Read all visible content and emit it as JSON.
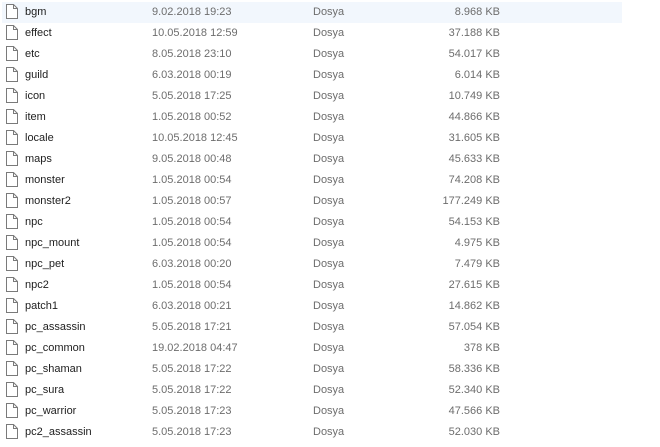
{
  "files": [
    {
      "name": "bgm",
      "date": "9.02.2018 19:23",
      "type": "Dosya",
      "size": "8.968 KB"
    },
    {
      "name": "effect",
      "date": "10.05.2018 12:59",
      "type": "Dosya",
      "size": "37.188 KB"
    },
    {
      "name": "etc",
      "date": "8.05.2018 23:10",
      "type": "Dosya",
      "size": "54.017 KB"
    },
    {
      "name": "guild",
      "date": "6.03.2018 00:19",
      "type": "Dosya",
      "size": "6.014 KB"
    },
    {
      "name": "icon",
      "date": "5.05.2018 17:25",
      "type": "Dosya",
      "size": "10.749 KB"
    },
    {
      "name": "item",
      "date": "1.05.2018 00:52",
      "type": "Dosya",
      "size": "44.866 KB"
    },
    {
      "name": "locale",
      "date": "10.05.2018 12:45",
      "type": "Dosya",
      "size": "31.605 KB"
    },
    {
      "name": "maps",
      "date": "9.05.2018 00:48",
      "type": "Dosya",
      "size": "45.633 KB"
    },
    {
      "name": "monster",
      "date": "1.05.2018 00:54",
      "type": "Dosya",
      "size": "74.208 KB"
    },
    {
      "name": "monster2",
      "date": "1.05.2018 00:57",
      "type": "Dosya",
      "size": "177.249 KB"
    },
    {
      "name": "npc",
      "date": "1.05.2018 00:54",
      "type": "Dosya",
      "size": "54.153 KB"
    },
    {
      "name": "npc_mount",
      "date": "1.05.2018 00:54",
      "type": "Dosya",
      "size": "4.975 KB"
    },
    {
      "name": "npc_pet",
      "date": "6.03.2018 00:20",
      "type": "Dosya",
      "size": "7.479 KB"
    },
    {
      "name": "npc2",
      "date": "1.05.2018 00:54",
      "type": "Dosya",
      "size": "27.615 KB"
    },
    {
      "name": "patch1",
      "date": "6.03.2018 00:21",
      "type": "Dosya",
      "size": "14.862 KB"
    },
    {
      "name": "pc_assassin",
      "date": "5.05.2018 17:21",
      "type": "Dosya",
      "size": "57.054 KB"
    },
    {
      "name": "pc_common",
      "date": "19.02.2018 04:47",
      "type": "Dosya",
      "size": "378 KB"
    },
    {
      "name": "pc_shaman",
      "date": "5.05.2018 17:22",
      "type": "Dosya",
      "size": "58.336 KB"
    },
    {
      "name": "pc_sura",
      "date": "5.05.2018 17:22",
      "type": "Dosya",
      "size": "52.340 KB"
    },
    {
      "name": "pc_warrior",
      "date": "5.05.2018 17:23",
      "type": "Dosya",
      "size": "47.566 KB"
    },
    {
      "name": "pc2_assassin",
      "date": "5.05.2018 17:23",
      "type": "Dosya",
      "size": "52.030 KB"
    }
  ],
  "icon": "file-icon",
  "colors": {
    "selection": "#f2f7fd",
    "meta_text": "#6d6d6d",
    "name_text": "#1e1e1e"
  }
}
